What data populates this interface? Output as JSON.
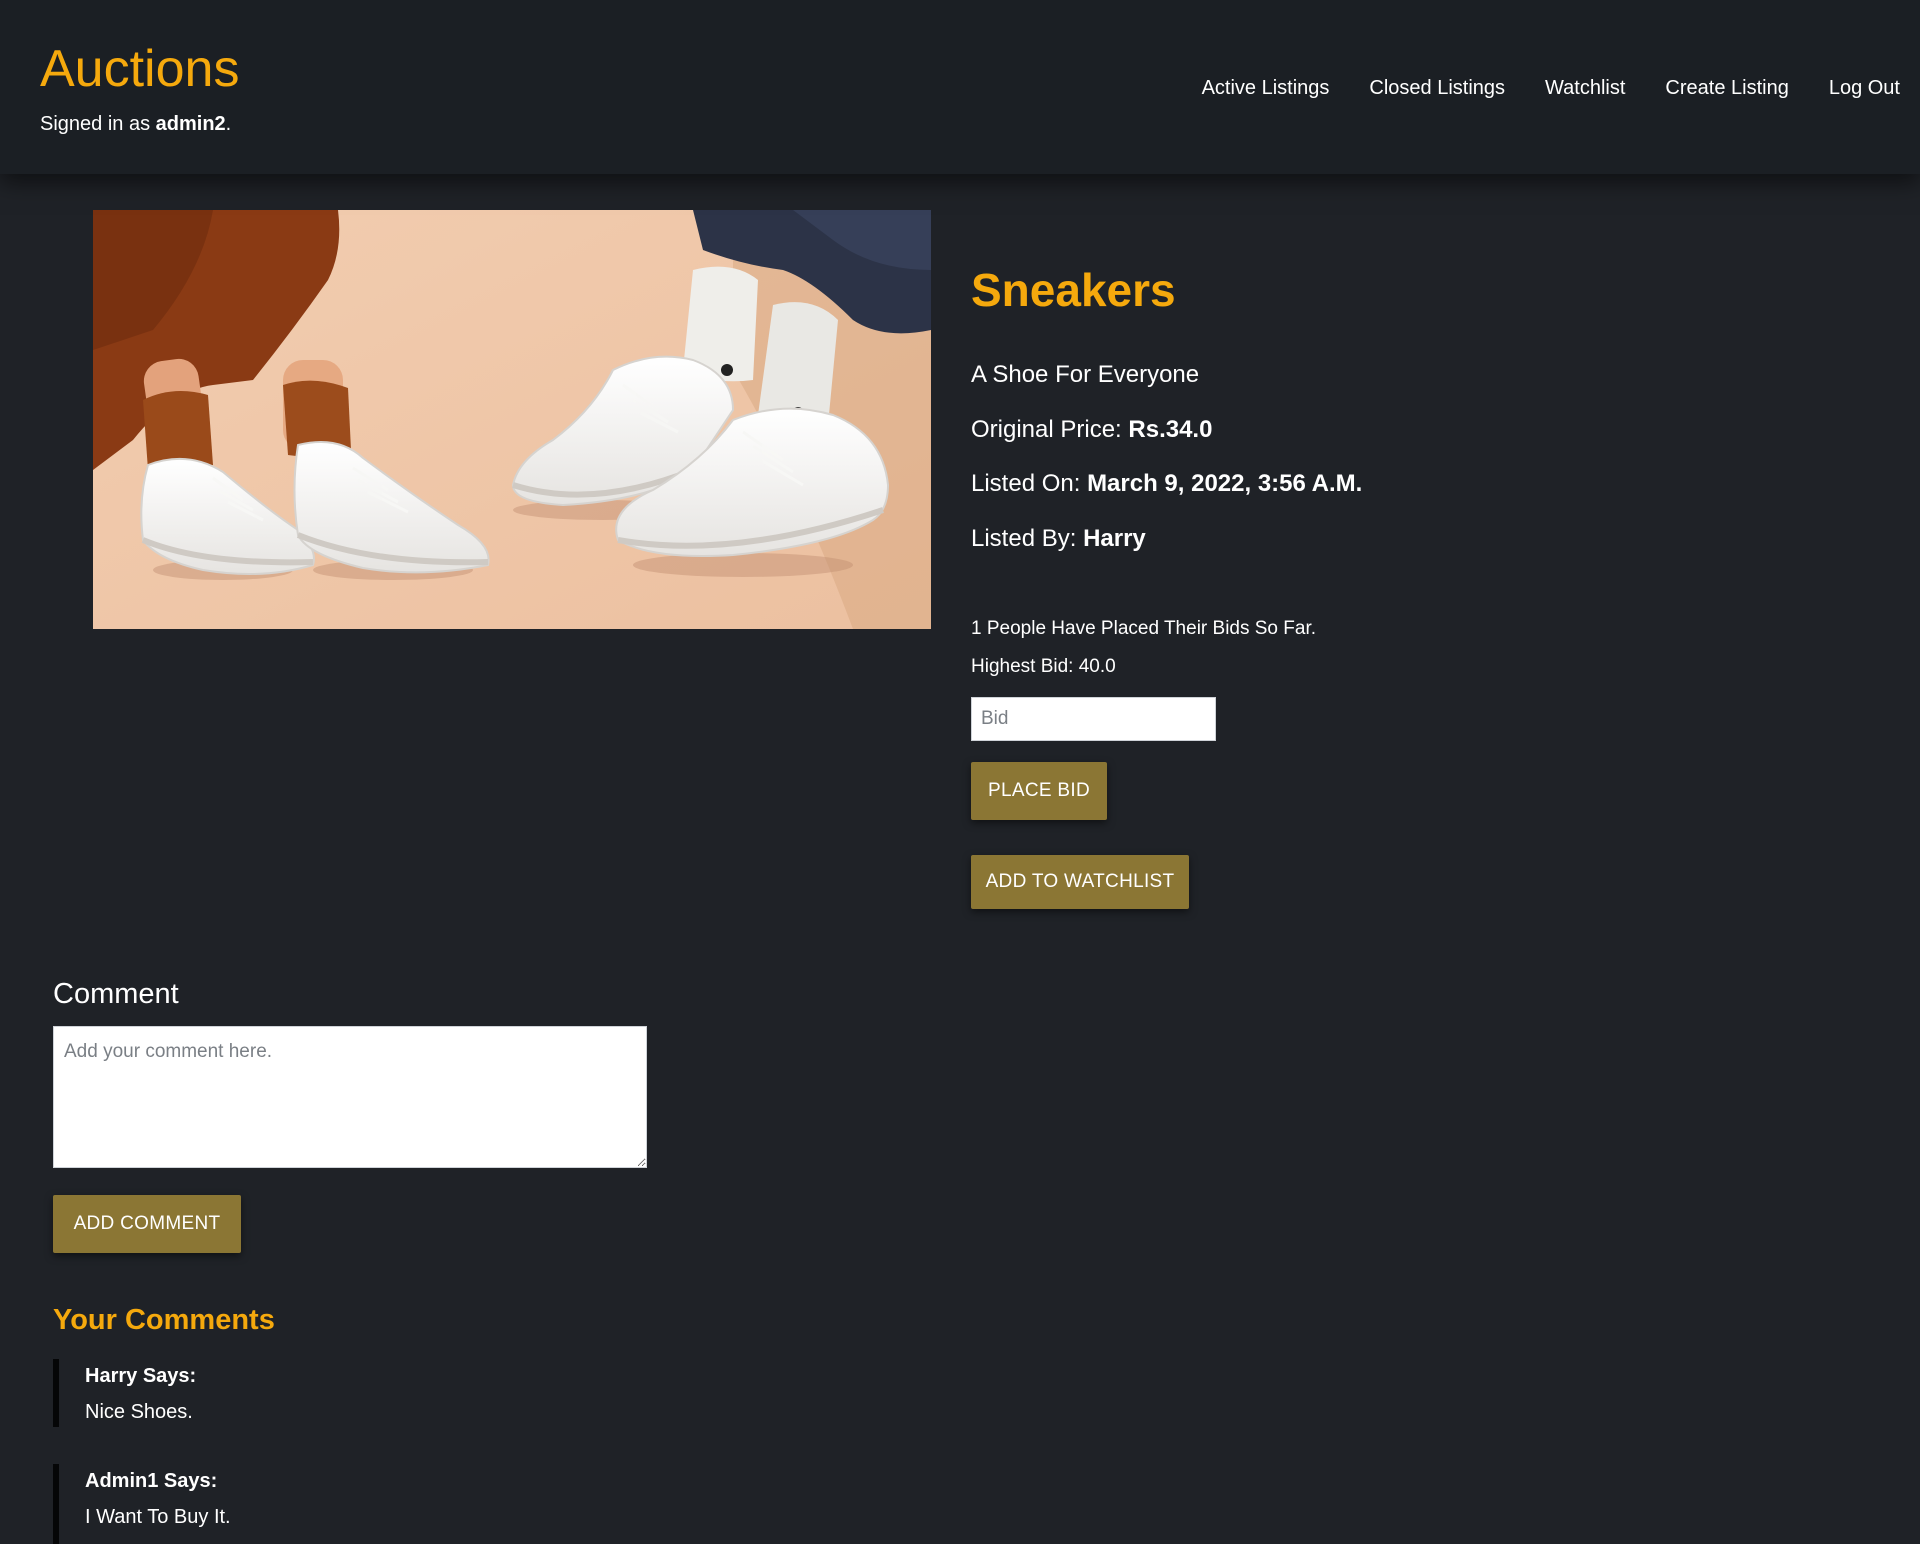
{
  "header": {
    "brand": "Auctions",
    "signed_in_prefix": "Signed in as ",
    "username": "admin2",
    "signed_in_suffix": ".",
    "nav": [
      {
        "label": "Active Listings"
      },
      {
        "label": "Closed Listings"
      },
      {
        "label": "Watchlist"
      },
      {
        "label": "Create Listing"
      },
      {
        "label": "Log Out"
      }
    ]
  },
  "listing": {
    "title": "Sneakers",
    "description": "A Shoe For Everyone",
    "price_label": "Original Price: ",
    "price_value": "Rs.34.0",
    "listed_on_label": "Listed On: ",
    "listed_on_value": "March 9, 2022, 3:56 A.M.",
    "listed_by_label": "Listed By: ",
    "listed_by_value": "Harry",
    "bid_count_text": "1 People Have Placed Their Bids So Far.",
    "highest_bid_text": "Highest Bid: 40.0",
    "bid_placeholder": "Bid",
    "bid_value": "",
    "place_bid_label": "Place Bid",
    "watchlist_label": "Add To Watchlist"
  },
  "comment_form": {
    "heading": "Comment",
    "placeholder": "Add your comment here.",
    "value": "",
    "submit_label": "Add Comment"
  },
  "comments": {
    "heading": "Your Comments",
    "items": [
      {
        "author": "Harry Says:",
        "text": "Nice Shoes."
      },
      {
        "author": "Admin1 Says:",
        "text": "I Want To Buy It."
      }
    ]
  },
  "colors": {
    "accent": "#f5a90d",
    "button": "#8b7634",
    "background": "#1f2227",
    "header": "#1b1f24"
  }
}
